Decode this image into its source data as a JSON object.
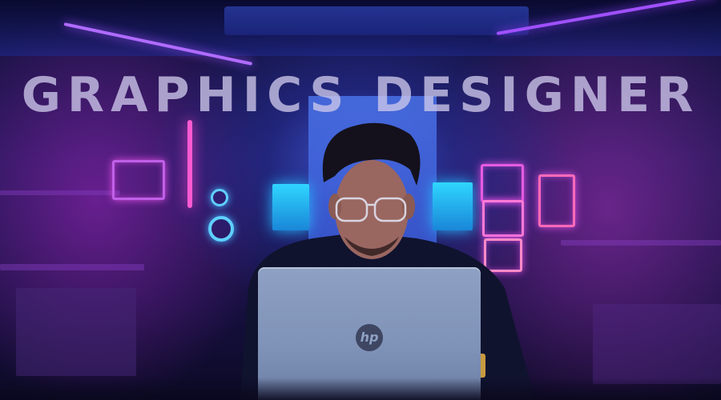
{
  "poster": {
    "headline": "GRAPHICS DESIGNER"
  },
  "laptop": {
    "brand_logo": "hp"
  },
  "colors": {
    "neon_pink": "#e55ce0",
    "neon_blue": "#2fd6ff",
    "room_purple": "#1a1650",
    "laptop_silver": "#8ea1c4"
  }
}
